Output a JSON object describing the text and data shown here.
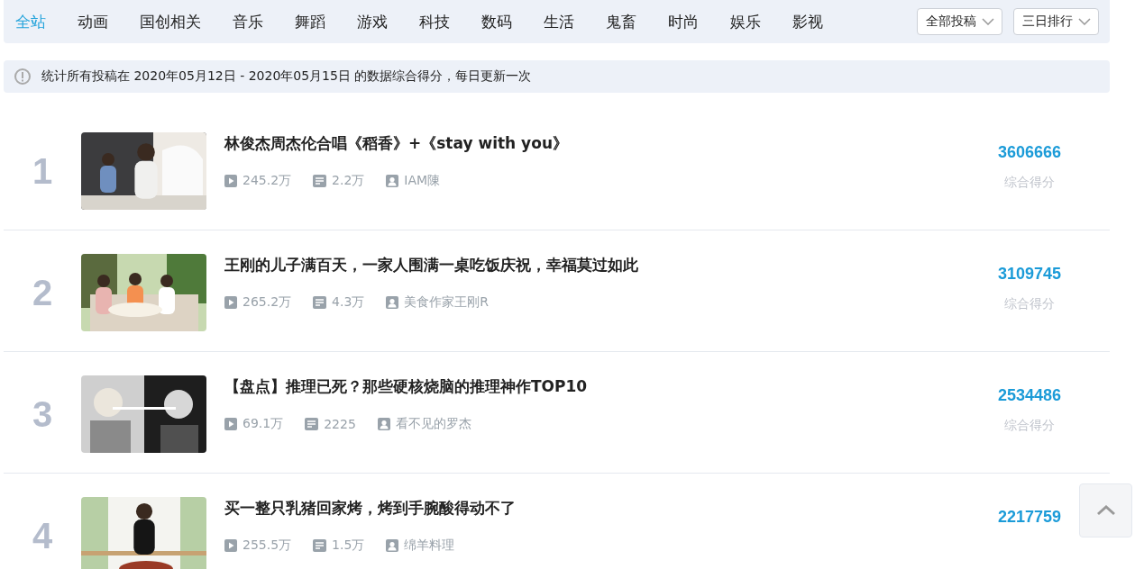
{
  "tabs": [
    {
      "label": "全站",
      "selected": true
    },
    {
      "label": "动画",
      "selected": false
    },
    {
      "label": "国创相关",
      "selected": false
    },
    {
      "label": "音乐",
      "selected": false
    },
    {
      "label": "舞蹈",
      "selected": false
    },
    {
      "label": "游戏",
      "selected": false
    },
    {
      "label": "科技",
      "selected": false
    },
    {
      "label": "数码",
      "selected": false
    },
    {
      "label": "生活",
      "selected": false
    },
    {
      "label": "鬼畜",
      "selected": false
    },
    {
      "label": "时尚",
      "selected": false
    },
    {
      "label": "娱乐",
      "selected": false
    },
    {
      "label": "影视",
      "selected": false
    }
  ],
  "filters": [
    {
      "label": "全部投稿"
    },
    {
      "label": "三日排行"
    }
  ],
  "notice": "统计所有投稿在 2020年05月12日 - 2020年05月15日 的数据综合得分，每日更新一次",
  "videos": [
    {
      "rank": "1",
      "title": "林俊杰周杰伦合唱《稻香》+《stay with you》",
      "plays": "245.2万",
      "comments": "2.2万",
      "author": "IAM陳",
      "score": "3606666",
      "score_label": "综合得分"
    },
    {
      "rank": "2",
      "title": "王刚的儿子满百天，一家人围满一桌吃饭庆祝，幸福莫过如此",
      "plays": "265.2万",
      "comments": "4.3万",
      "author": "美食作家王刚R",
      "score": "3109745",
      "score_label": "综合得分"
    },
    {
      "rank": "3",
      "title": "【盘点】推理已死？那些硬核烧脑的推理神作TOP10",
      "plays": "69.1万",
      "comments": "2225",
      "author": "看不见的罗杰",
      "score": "2534486",
      "score_label": "综合得分"
    },
    {
      "rank": "4",
      "title": "买一整只乳猪回家烤，烤到手腕酸得动不了",
      "plays": "255.5万",
      "comments": "1.5万",
      "author": "绵羊料理",
      "score": "2217759"
    }
  ]
}
